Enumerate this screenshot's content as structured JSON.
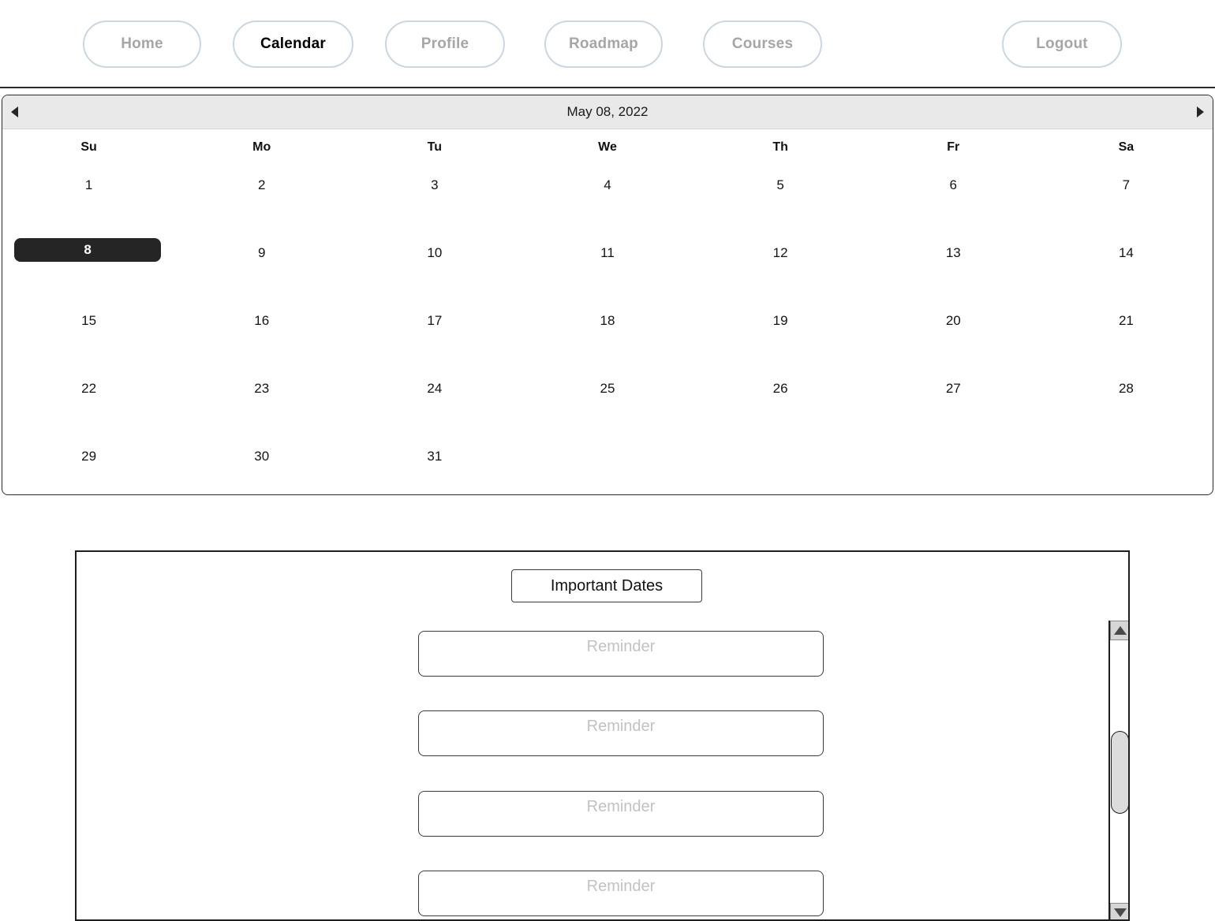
{
  "nav": {
    "items": [
      {
        "id": "home",
        "label": "Home",
        "active": false
      },
      {
        "id": "calendar",
        "label": "Calendar",
        "active": true
      },
      {
        "id": "profile",
        "label": "Profile",
        "active": false
      },
      {
        "id": "roadmap",
        "label": "Roadmap",
        "active": false
      },
      {
        "id": "courses",
        "label": "Courses",
        "active": false
      }
    ],
    "logout_label": "Logout"
  },
  "calendar": {
    "title": "May 08, 2022",
    "prev_icon": "triangle-left-icon",
    "next_icon": "triangle-right-icon",
    "weekdays": [
      "Su",
      "Mo",
      "Tu",
      "We",
      "Th",
      "Fr",
      "Sa"
    ],
    "selected_day": "8",
    "weeks": [
      [
        "1",
        "2",
        "3",
        "4",
        "5",
        "6",
        "7"
      ],
      [
        "8",
        "9",
        "10",
        "11",
        "12",
        "13",
        "14"
      ],
      [
        "15",
        "16",
        "17",
        "18",
        "19",
        "20",
        "21"
      ],
      [
        "22",
        "23",
        "24",
        "25",
        "26",
        "27",
        "28"
      ],
      [
        "29",
        "30",
        "31",
        "",
        "",
        "",
        ""
      ]
    ]
  },
  "dates_panel": {
    "header_label": "Important Dates",
    "reminders": [
      {
        "value": "",
        "placeholder": "Reminder"
      },
      {
        "value": "",
        "placeholder": "Reminder"
      },
      {
        "value": "",
        "placeholder": "Reminder"
      },
      {
        "value": "",
        "placeholder": "Reminder"
      }
    ],
    "scrollbar": {
      "up_icon": "triangle-up-icon",
      "down_icon": "triangle-down-icon",
      "thumb_icon": "scrollbar-thumb"
    }
  },
  "colors": {
    "nav_border": "#ccd6e0",
    "nav_inactive_text": "#a6a6a6",
    "nav_active_text": "#000000",
    "header_bg": "#e9e9e9",
    "selected_day_bg": "#252525",
    "panel_border": "#1e1e1e",
    "placeholder": "#c2c2c2"
  }
}
